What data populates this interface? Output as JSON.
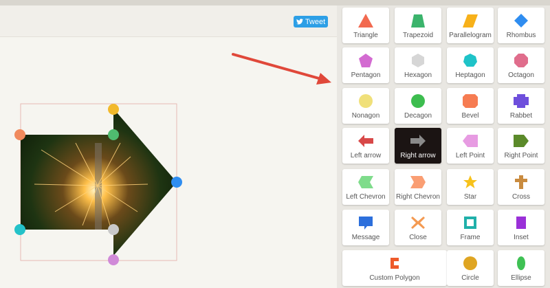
{
  "header": {
    "tweet_label": "Tweet"
  },
  "colors": {
    "accent_tweet": "#2d9fe6",
    "annotation_arrow": "#e0483a",
    "selected_tile": "#1b1413",
    "handles": [
      "#f08a5d",
      "#f2b92c",
      "#4fbb6f",
      "#2f8df0",
      "#24c2c9",
      "#c9c9c9",
      "#d08ad8"
    ]
  },
  "shapes": [
    {
      "label": "Triangle",
      "icon": "triangle-icon",
      "color": "#f26a50"
    },
    {
      "label": "Trapezoid",
      "icon": "trapezoid-icon",
      "color": "#3bb46c"
    },
    {
      "label": "Parallelogram",
      "icon": "parallelogram-icon",
      "color": "#f7b11a"
    },
    {
      "label": "Rhombus",
      "icon": "rhombus-icon",
      "color": "#2f8df0"
    },
    {
      "label": "Pentagon",
      "icon": "pentagon-icon",
      "color": "#d36bd1"
    },
    {
      "label": "Hexagon",
      "icon": "hexagon-icon",
      "color": "#d6d6d6"
    },
    {
      "label": "Heptagon",
      "icon": "heptagon-icon",
      "color": "#1fc3c8"
    },
    {
      "label": "Octagon",
      "icon": "octagon-icon",
      "color": "#e06d8c"
    },
    {
      "label": "Nonagon",
      "icon": "nonagon-icon",
      "color": "#f0e07a"
    },
    {
      "label": "Decagon",
      "icon": "decagon-icon",
      "color": "#3dbd4f"
    },
    {
      "label": "Bevel",
      "icon": "bevel-icon",
      "color": "#f67c52"
    },
    {
      "label": "Rabbet",
      "icon": "rabbet-icon",
      "color": "#6e4fdc"
    },
    {
      "label": "Left arrow",
      "icon": "left-arrow-icon",
      "color": "#d84848"
    },
    {
      "label": "Right arrow",
      "icon": "right-arrow-icon",
      "color": "#8a8a8a",
      "selected": true
    },
    {
      "label": "Left Point",
      "icon": "left-point-icon",
      "color": "#e79be2"
    },
    {
      "label": "Right Point",
      "icon": "right-point-icon",
      "color": "#5b8a2a"
    },
    {
      "label": "Left Chevron",
      "icon": "left-chevron-icon",
      "color": "#7fdc8b"
    },
    {
      "label": "Right Chevron",
      "icon": "right-chevron-icon",
      "color": "#fa9e73"
    },
    {
      "label": "Star",
      "icon": "star-icon",
      "color": "#f7c21b"
    },
    {
      "label": "Cross",
      "icon": "cross-icon",
      "color": "#c98b3f"
    },
    {
      "label": "Message",
      "icon": "message-icon",
      "color": "#2c6fdc"
    },
    {
      "label": "Close",
      "icon": "close-icon",
      "color": "#f49a52"
    },
    {
      "label": "Frame",
      "icon": "frame-icon",
      "color": "#20b0aa"
    },
    {
      "label": "Inset",
      "icon": "inset-icon",
      "color": "#9a30d8"
    },
    {
      "label": "Custom Polygon",
      "icon": "custom-polygon-icon",
      "color": "#ee5a2a"
    },
    {
      "label": "Circle",
      "icon": "circle-icon",
      "color": "#dfa522"
    },
    {
      "label": "Ellipse",
      "icon": "ellipse-icon",
      "color": "#3fc154"
    }
  ]
}
